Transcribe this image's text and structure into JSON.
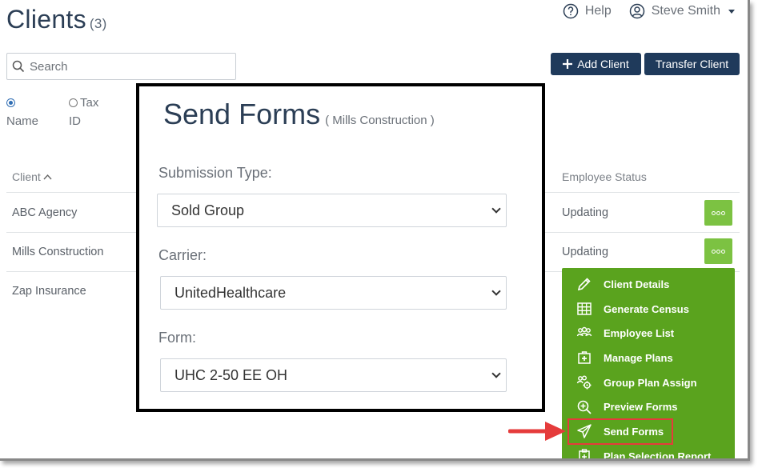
{
  "page": {
    "title": "Clients",
    "count": "(3)"
  },
  "topbar": {
    "help_label": "Help",
    "user_name": "Steve Smith"
  },
  "search": {
    "placeholder": "Search"
  },
  "buttons": {
    "add_client": "Add Client",
    "transfer_client": "Transfer Client"
  },
  "search_by": {
    "options": [
      {
        "line1": "",
        "line2": "Name",
        "selected": true
      },
      {
        "line1": "Tax",
        "line2": "ID",
        "selected": false
      }
    ]
  },
  "table": {
    "columns": {
      "client": "Client",
      "status": "Employee Status"
    },
    "rows": [
      {
        "client": "ABC Agency",
        "status": "Updating"
      },
      {
        "client": "Mills Construction",
        "status": "Updating"
      },
      {
        "client": "Zap Insurance",
        "status": ""
      }
    ]
  },
  "action_menu": {
    "items": [
      {
        "label": "Client Details",
        "icon": "pencil-icon"
      },
      {
        "label": "Generate Census",
        "icon": "grid-icon"
      },
      {
        "label": "Employee List",
        "icon": "users-icon"
      },
      {
        "label": "Manage Plans",
        "icon": "medical-case-icon"
      },
      {
        "label": "Group Plan Assign",
        "icon": "users-gear-icon"
      },
      {
        "label": "Preview Forms",
        "icon": "zoom-in-icon"
      },
      {
        "label": "Send Forms",
        "icon": "paper-plane-icon",
        "highlighted": true
      },
      {
        "label": "Plan Selection Report",
        "icon": "clipboard-icon"
      }
    ]
  },
  "modal": {
    "title": "Send Forms",
    "subtitle": "( Mills Construction )",
    "fields": [
      {
        "label": "Submission Type:",
        "value": "Sold Group"
      },
      {
        "label": "Carrier:",
        "value": "UnitedHealthcare"
      },
      {
        "label": "Form:",
        "value": "UHC 2-50 EE OH"
      }
    ]
  },
  "colors": {
    "navy": "#1f3a5b",
    "menu_green": "#5aa31e",
    "dots_green": "#7cc242",
    "highlight_red": "#e53b3b"
  }
}
